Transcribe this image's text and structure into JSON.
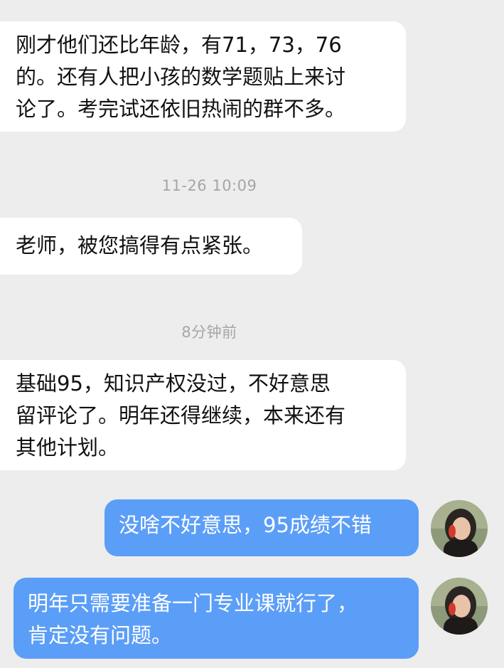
{
  "chat": {
    "messages": [
      {
        "direction": "incoming",
        "text": "刚才他们还比年龄，有71，73，76\n的。还有人把小孩的数学题贴上来讨\n论了。考完试还依旧热闹的群不多。"
      },
      {
        "direction": "incoming",
        "text": "老师，被您搞得有点紧张。"
      },
      {
        "direction": "incoming",
        "text": "基础95，知识产权没过，不好意思\n留评论了。明年还得继续，本来还有\n其他计划。"
      },
      {
        "direction": "outgoing",
        "text": "没啥不好意思，95成绩不错"
      },
      {
        "direction": "outgoing",
        "text": "明年只需要准备一门专业课就行了，\n肯定没有问题。"
      }
    ],
    "timestamps": [
      "11-26 10:09",
      "8分钟前"
    ],
    "avatar_icon": "user-avatar-photo"
  },
  "colors": {
    "background": "#ededed",
    "incoming_bubble": "#ffffff",
    "outgoing_bubble": "#5b9ef7",
    "timestamp_text": "#a6a6a6"
  }
}
